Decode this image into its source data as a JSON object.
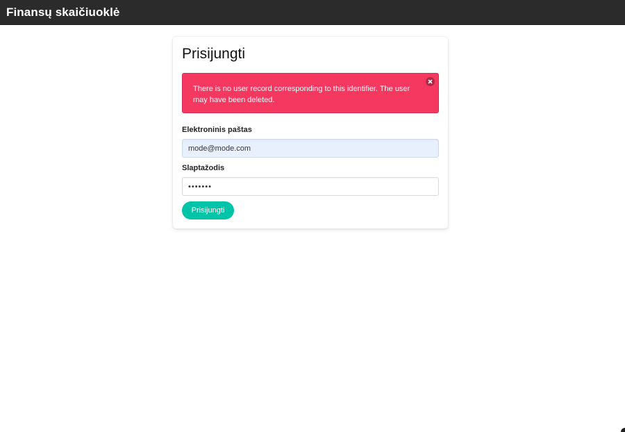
{
  "navbar": {
    "brand": "Finansų skaičiuoklė"
  },
  "login_form": {
    "title": "Prisijungti",
    "error_message": "There is no user record corresponding to this identifier. The user may have been deleted.",
    "email": {
      "label": "Elektroninis paštas",
      "value": "mode@mode.com"
    },
    "password": {
      "label": "Slaptažodis",
      "value": "•••••••"
    },
    "submit_label": "Prisijungti"
  },
  "colors": {
    "navbar": "#2b2b2b",
    "error": "#f4385f",
    "primary_button": "#00c4a7",
    "autofill": "#e8f0fe"
  },
  "icons": {
    "close": "close-icon"
  }
}
